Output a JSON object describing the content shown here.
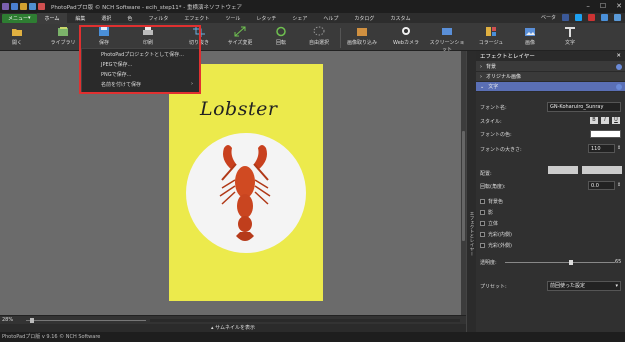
{
  "window": {
    "title": "PhotoPadプロ版 © NCH Software - ecih_step11* - 重横演ネソフトウェア"
  },
  "menu": {
    "main_button": "メニュー",
    "tabs": [
      "ホーム",
      "編集",
      "選択",
      "色",
      "フィルタ",
      "エフェクト",
      "ツール",
      "レタッチ",
      "シェア",
      "ヘルプ",
      "カタログ",
      "カスタム"
    ],
    "beta": "ベータ"
  },
  "toolbar": {
    "open": "開く",
    "library": "ライブラリ",
    "save": "保存",
    "print": "印刷",
    "crop": "切り抜き",
    "resize": "サイズ変更",
    "rotate": "回転",
    "free_select": "自由選択",
    "import": "画像取り込み",
    "webcam": "Webカメラ",
    "screenshot": "スクリーンショット",
    "collage": "コラージュ",
    "image": "画像",
    "text": "文字"
  },
  "save_menu": {
    "items": [
      "PhotoPadプロジェクトとして保存...",
      "JPEGで保存...",
      "PNGで保存...",
      "名前を付けて保存"
    ]
  },
  "canvas": {
    "image_title": "Lobster",
    "zoom": "28%",
    "thumbnail_toggle": "サムネイルを表示"
  },
  "panel": {
    "title": "エフェクトとレイヤー",
    "sections": [
      "背景",
      "オリジナル画像",
      "文字"
    ],
    "font_name_label": "フォント名:",
    "font_name_value": "GN-Koharuiro_Sunray",
    "style_label": "スタイル:",
    "style_buttons": [
      "B",
      "I",
      "U"
    ],
    "font_color_label": "フォントの色:",
    "font_size_label": "フォントの大きさ:",
    "font_size_value": "110",
    "align_label": "配置:",
    "rotation_label": "回転(角度):",
    "rotation_value": "0.0",
    "checkboxes": [
      "背景色",
      "影",
      "立体",
      "光彩(内側)",
      "光彩(外側)"
    ],
    "opacity_label": "透明度:",
    "opacity_value": "65",
    "preset_label": "プリセット:",
    "preset_value": "前回使った設定",
    "side_tab": "エフェクトとレイヤー"
  },
  "statusbar": {
    "text": "PhotoPadプロ版 v 9.16 © NCH Software"
  },
  "colors": {
    "accent_green": "#2e7d32",
    "highlight_red": "#e03030",
    "section_active": "#5a6fb5",
    "image_bg": "#ecea4c"
  }
}
